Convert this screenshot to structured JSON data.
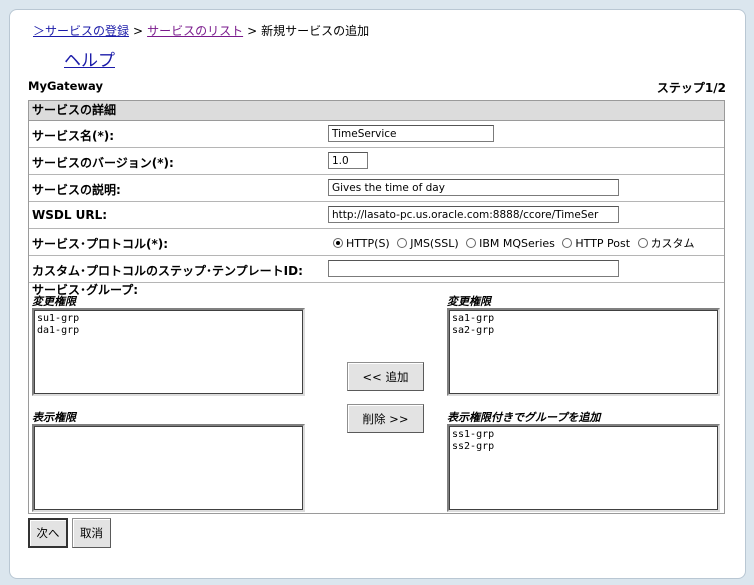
{
  "breadcrumb": {
    "items": [
      "＞サービスの登録",
      "サービスのリスト"
    ],
    "separator": ">",
    "current": "新規サービスの追加"
  },
  "help_link": "ヘルプ",
  "gateway_label": "MyGateway",
  "step_label": "ステップ1/2",
  "section_title": "サービスの詳細",
  "fields": {
    "service_name": {
      "label": "サービス名(*):",
      "value": "TimeService"
    },
    "service_version": {
      "label": "サービスのバージョン(*):",
      "value": "1.0"
    },
    "service_description": {
      "label": "サービスの説明:",
      "value": "Gives the time of day"
    },
    "wsdl_url": {
      "label": "WSDL URL:",
      "value": "http://lasato-pc.us.oracle.com:8888/ccore/TimeSer"
    },
    "protocol": {
      "label": "サービス･プロトコル(*):",
      "options": [
        "HTTP(S)",
        "JMS(SSL)",
        "IBM MQSeries",
        "HTTP Post",
        "カスタム"
      ],
      "selected": "HTTP(S)"
    },
    "custom_template": {
      "label": "カスタム･プロトコルのステップ･テンプレートID:",
      "value": ""
    }
  },
  "groups": {
    "label": "サービス･グループ:",
    "left_modify_label": "変更権限",
    "left_modify_items": [
      "su1-grp",
      "da1-grp"
    ],
    "left_view_label": "表示権限",
    "left_view_items": [],
    "right_modify_label": "変更権限",
    "right_modify_items": [
      "sa1-grp",
      "sa2-grp"
    ],
    "right_view_label": "表示権限付きでグループを追加",
    "right_view_items": [
      "ss1-grp",
      "ss2-grp"
    ]
  },
  "buttons": {
    "add": "<<  追加",
    "remove": "削除  >>",
    "next": "次へ",
    "cancel": "取消"
  }
}
